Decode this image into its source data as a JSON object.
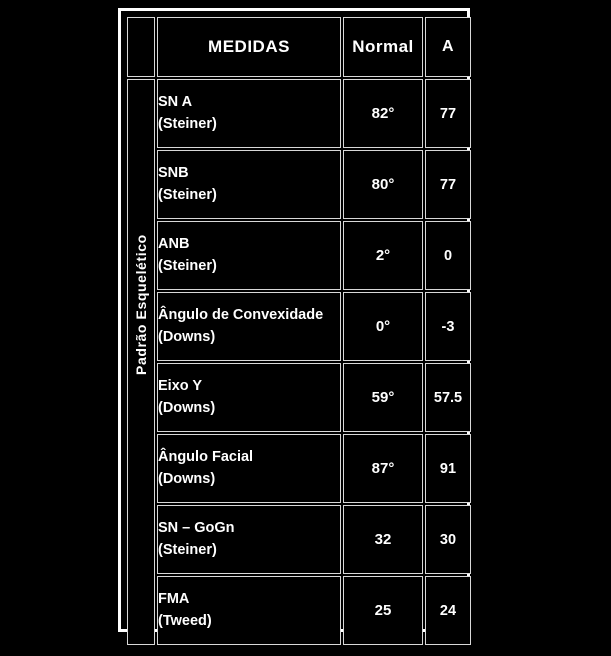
{
  "table": {
    "row_group_label": "Padrão Esquelético",
    "headers": {
      "corner": "",
      "measures": "MEDIDAS",
      "normal": "Normal",
      "patient": "A"
    },
    "rows": [
      {
        "measure": "SN A",
        "author": " (Steiner)",
        "normal": "82°",
        "patient": "77"
      },
      {
        "measure": "SNB",
        "author": "(Steiner)",
        "normal": "80°",
        "patient": "77"
      },
      {
        "measure": "ANB",
        "author": "(Steiner)",
        "normal": "2°",
        "patient": "0"
      },
      {
        "measure": "Ângulo de Convexidade",
        "author": "(Downs)",
        "normal": "0°",
        "patient": "-3"
      },
      {
        "measure": "Eixo Y",
        "author": "(Downs)",
        "normal": "59°",
        "patient": "57.5"
      },
      {
        "measure": "Ângulo Facial",
        "author": "(Downs)",
        "normal": "87°",
        "patient": "91"
      },
      {
        "measure": "SN – GoGn",
        "author": "(Steiner)",
        "normal": "32",
        "patient": "30"
      },
      {
        "measure": "FMA",
        "author": "(Tweed)",
        "normal": "25",
        "patient": "24"
      }
    ]
  },
  "colors": {
    "background": "#000000",
    "foreground": "#ffffff",
    "grid_line": "#d8d8d8"
  }
}
